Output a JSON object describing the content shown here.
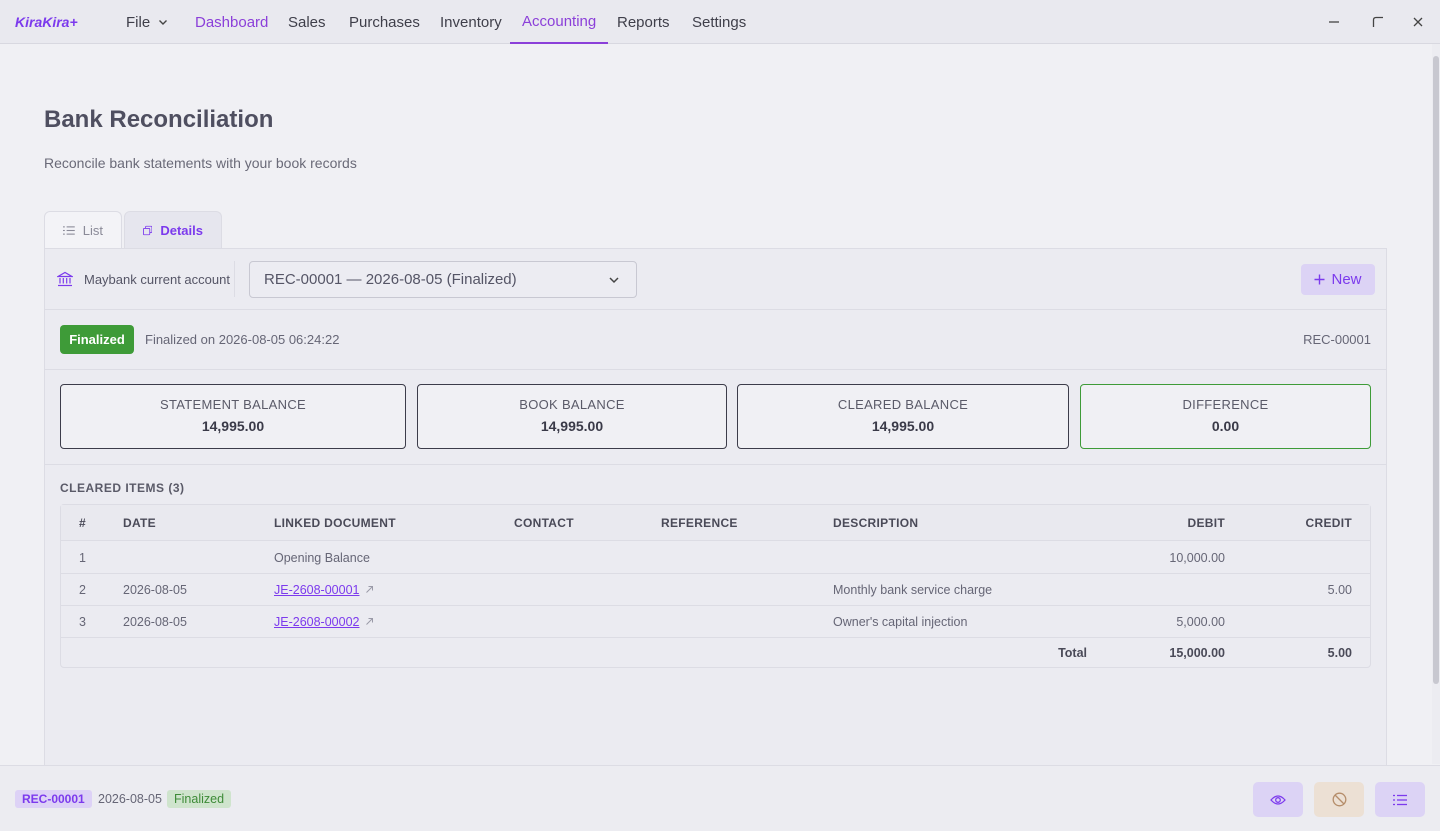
{
  "app": {
    "logo": "KiraKira+",
    "menu": {
      "file": "File",
      "items": [
        "Dashboard",
        "Sales",
        "Purchases",
        "Inventory",
        "Accounting",
        "Reports",
        "Settings"
      ]
    }
  },
  "page": {
    "title": "Bank Reconciliation",
    "subtitle": "Reconcile bank statements with your book records"
  },
  "tabs": {
    "list": "List",
    "details": "Details"
  },
  "toolbar": {
    "bank_account": "Maybank current account",
    "selected_reconciliation": "REC-00001 — 2026-08-05 (Finalized)",
    "new_label": "New"
  },
  "status": {
    "badge": "Finalized",
    "finalized_on": "Finalized on 2026-08-05 06:24:22",
    "rec_id": "REC-00001"
  },
  "summary": {
    "statement_label": "STATEMENT BALANCE",
    "statement_value": "14,995.00",
    "book_label": "BOOK BALANCE",
    "book_value": "14,995.00",
    "cleared_label": "CLEARED BALANCE",
    "cleared_value": "14,995.00",
    "difference_label": "DIFFERENCE",
    "difference_value": "0.00"
  },
  "cleared": {
    "title": "CLEARED ITEMS (3)",
    "headers": {
      "num": "#",
      "date": "DATE",
      "linked": "LINKED DOCUMENT",
      "contact": "CONTACT",
      "reference": "REFERENCE",
      "description": "DESCRIPTION",
      "debit": "DEBIT",
      "credit": "CREDIT"
    },
    "rows": [
      {
        "num": "1",
        "date": "",
        "linked": "Opening Balance",
        "contact": "",
        "reference": "",
        "description": "",
        "debit": "10,000.00",
        "credit": ""
      },
      {
        "num": "2",
        "date": "2026-08-05",
        "linked": "JE-2608-00001",
        "contact": "",
        "reference": "",
        "description": "Monthly bank service charge",
        "debit": "",
        "credit": "5.00"
      },
      {
        "num": "3",
        "date": "2026-08-05",
        "linked": "JE-2608-00002",
        "contact": "",
        "reference": "",
        "description": "Owner's capital injection",
        "debit": "5,000.00",
        "credit": ""
      }
    ],
    "total_label": "Total",
    "total_debit": "15,000.00",
    "total_credit": "5.00"
  },
  "footer": {
    "rec_id": "REC-00001",
    "date": "2026-08-05",
    "status": "Finalized"
  },
  "colors": {
    "accent": "#7c3aed",
    "success": "#3e9b38",
    "background": "#f0f0f4"
  }
}
